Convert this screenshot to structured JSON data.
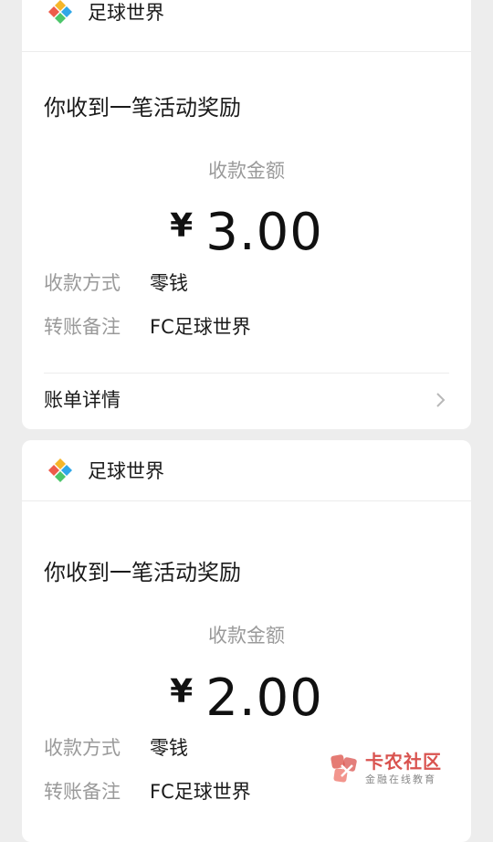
{
  "cards": [
    {
      "app_name": "足球世界",
      "headline": "你收到一笔活动奖励",
      "amount_label": "收款金额",
      "currency": "¥",
      "amount": "3.00",
      "method_key": "收款方式",
      "method_value": "零钱",
      "note_key": "转账备注",
      "note_value": "FC足球世界",
      "detail_label": "账单详情"
    },
    {
      "app_name": "足球世界",
      "headline": "你收到一笔活动奖励",
      "amount_label": "收款金额",
      "currency": "¥",
      "amount": "2.00",
      "method_key": "收款方式",
      "method_value": "零钱",
      "note_key": "转账备注",
      "note_value": "FC足球世界"
    }
  ],
  "watermark": {
    "title": "卡农社区",
    "subtitle": "金融在线教育"
  },
  "icons": {
    "app_logo": "football-world-logo-icon",
    "chevron": "chevron-right-icon",
    "watermark_logo": "kanong-logo-icon"
  },
  "colors": {
    "background": "#ededed",
    "card": "#ffffff",
    "muted_text": "#9a9a9a",
    "watermark_red": "#d9534f"
  }
}
